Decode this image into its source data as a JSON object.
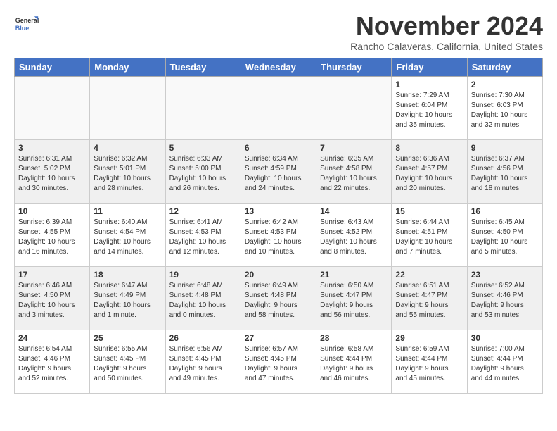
{
  "header": {
    "logo_line1": "General",
    "logo_line2": "Blue",
    "month": "November 2024",
    "location": "Rancho Calaveras, California, United States"
  },
  "weekdays": [
    "Sunday",
    "Monday",
    "Tuesday",
    "Wednesday",
    "Thursday",
    "Friday",
    "Saturday"
  ],
  "weeks": [
    [
      {
        "day": "",
        "info": ""
      },
      {
        "day": "",
        "info": ""
      },
      {
        "day": "",
        "info": ""
      },
      {
        "day": "",
        "info": ""
      },
      {
        "day": "",
        "info": ""
      },
      {
        "day": "1",
        "info": "Sunrise: 7:29 AM\nSunset: 6:04 PM\nDaylight: 10 hours\nand 35 minutes."
      },
      {
        "day": "2",
        "info": "Sunrise: 7:30 AM\nSunset: 6:03 PM\nDaylight: 10 hours\nand 32 minutes."
      }
    ],
    [
      {
        "day": "3",
        "info": "Sunrise: 6:31 AM\nSunset: 5:02 PM\nDaylight: 10 hours\nand 30 minutes."
      },
      {
        "day": "4",
        "info": "Sunrise: 6:32 AM\nSunset: 5:01 PM\nDaylight: 10 hours\nand 28 minutes."
      },
      {
        "day": "5",
        "info": "Sunrise: 6:33 AM\nSunset: 5:00 PM\nDaylight: 10 hours\nand 26 minutes."
      },
      {
        "day": "6",
        "info": "Sunrise: 6:34 AM\nSunset: 4:59 PM\nDaylight: 10 hours\nand 24 minutes."
      },
      {
        "day": "7",
        "info": "Sunrise: 6:35 AM\nSunset: 4:58 PM\nDaylight: 10 hours\nand 22 minutes."
      },
      {
        "day": "8",
        "info": "Sunrise: 6:36 AM\nSunset: 4:57 PM\nDaylight: 10 hours\nand 20 minutes."
      },
      {
        "day": "9",
        "info": "Sunrise: 6:37 AM\nSunset: 4:56 PM\nDaylight: 10 hours\nand 18 minutes."
      }
    ],
    [
      {
        "day": "10",
        "info": "Sunrise: 6:39 AM\nSunset: 4:55 PM\nDaylight: 10 hours\nand 16 minutes."
      },
      {
        "day": "11",
        "info": "Sunrise: 6:40 AM\nSunset: 4:54 PM\nDaylight: 10 hours\nand 14 minutes."
      },
      {
        "day": "12",
        "info": "Sunrise: 6:41 AM\nSunset: 4:53 PM\nDaylight: 10 hours\nand 12 minutes."
      },
      {
        "day": "13",
        "info": "Sunrise: 6:42 AM\nSunset: 4:53 PM\nDaylight: 10 hours\nand 10 minutes."
      },
      {
        "day": "14",
        "info": "Sunrise: 6:43 AM\nSunset: 4:52 PM\nDaylight: 10 hours\nand 8 minutes."
      },
      {
        "day": "15",
        "info": "Sunrise: 6:44 AM\nSunset: 4:51 PM\nDaylight: 10 hours\nand 7 minutes."
      },
      {
        "day": "16",
        "info": "Sunrise: 6:45 AM\nSunset: 4:50 PM\nDaylight: 10 hours\nand 5 minutes."
      }
    ],
    [
      {
        "day": "17",
        "info": "Sunrise: 6:46 AM\nSunset: 4:50 PM\nDaylight: 10 hours\nand 3 minutes."
      },
      {
        "day": "18",
        "info": "Sunrise: 6:47 AM\nSunset: 4:49 PM\nDaylight: 10 hours\nand 1 minute."
      },
      {
        "day": "19",
        "info": "Sunrise: 6:48 AM\nSunset: 4:48 PM\nDaylight: 10 hours\nand 0 minutes."
      },
      {
        "day": "20",
        "info": "Sunrise: 6:49 AM\nSunset: 4:48 PM\nDaylight: 9 hours\nand 58 minutes."
      },
      {
        "day": "21",
        "info": "Sunrise: 6:50 AM\nSunset: 4:47 PM\nDaylight: 9 hours\nand 56 minutes."
      },
      {
        "day": "22",
        "info": "Sunrise: 6:51 AM\nSunset: 4:47 PM\nDaylight: 9 hours\nand 55 minutes."
      },
      {
        "day": "23",
        "info": "Sunrise: 6:52 AM\nSunset: 4:46 PM\nDaylight: 9 hours\nand 53 minutes."
      }
    ],
    [
      {
        "day": "24",
        "info": "Sunrise: 6:54 AM\nSunset: 4:46 PM\nDaylight: 9 hours\nand 52 minutes."
      },
      {
        "day": "25",
        "info": "Sunrise: 6:55 AM\nSunset: 4:45 PM\nDaylight: 9 hours\nand 50 minutes."
      },
      {
        "day": "26",
        "info": "Sunrise: 6:56 AM\nSunset: 4:45 PM\nDaylight: 9 hours\nand 49 minutes."
      },
      {
        "day": "27",
        "info": "Sunrise: 6:57 AM\nSunset: 4:45 PM\nDaylight: 9 hours\nand 47 minutes."
      },
      {
        "day": "28",
        "info": "Sunrise: 6:58 AM\nSunset: 4:44 PM\nDaylight: 9 hours\nand 46 minutes."
      },
      {
        "day": "29",
        "info": "Sunrise: 6:59 AM\nSunset: 4:44 PM\nDaylight: 9 hours\nand 45 minutes."
      },
      {
        "day": "30",
        "info": "Sunrise: 7:00 AM\nSunset: 4:44 PM\nDaylight: 9 hours\nand 44 minutes."
      }
    ]
  ]
}
